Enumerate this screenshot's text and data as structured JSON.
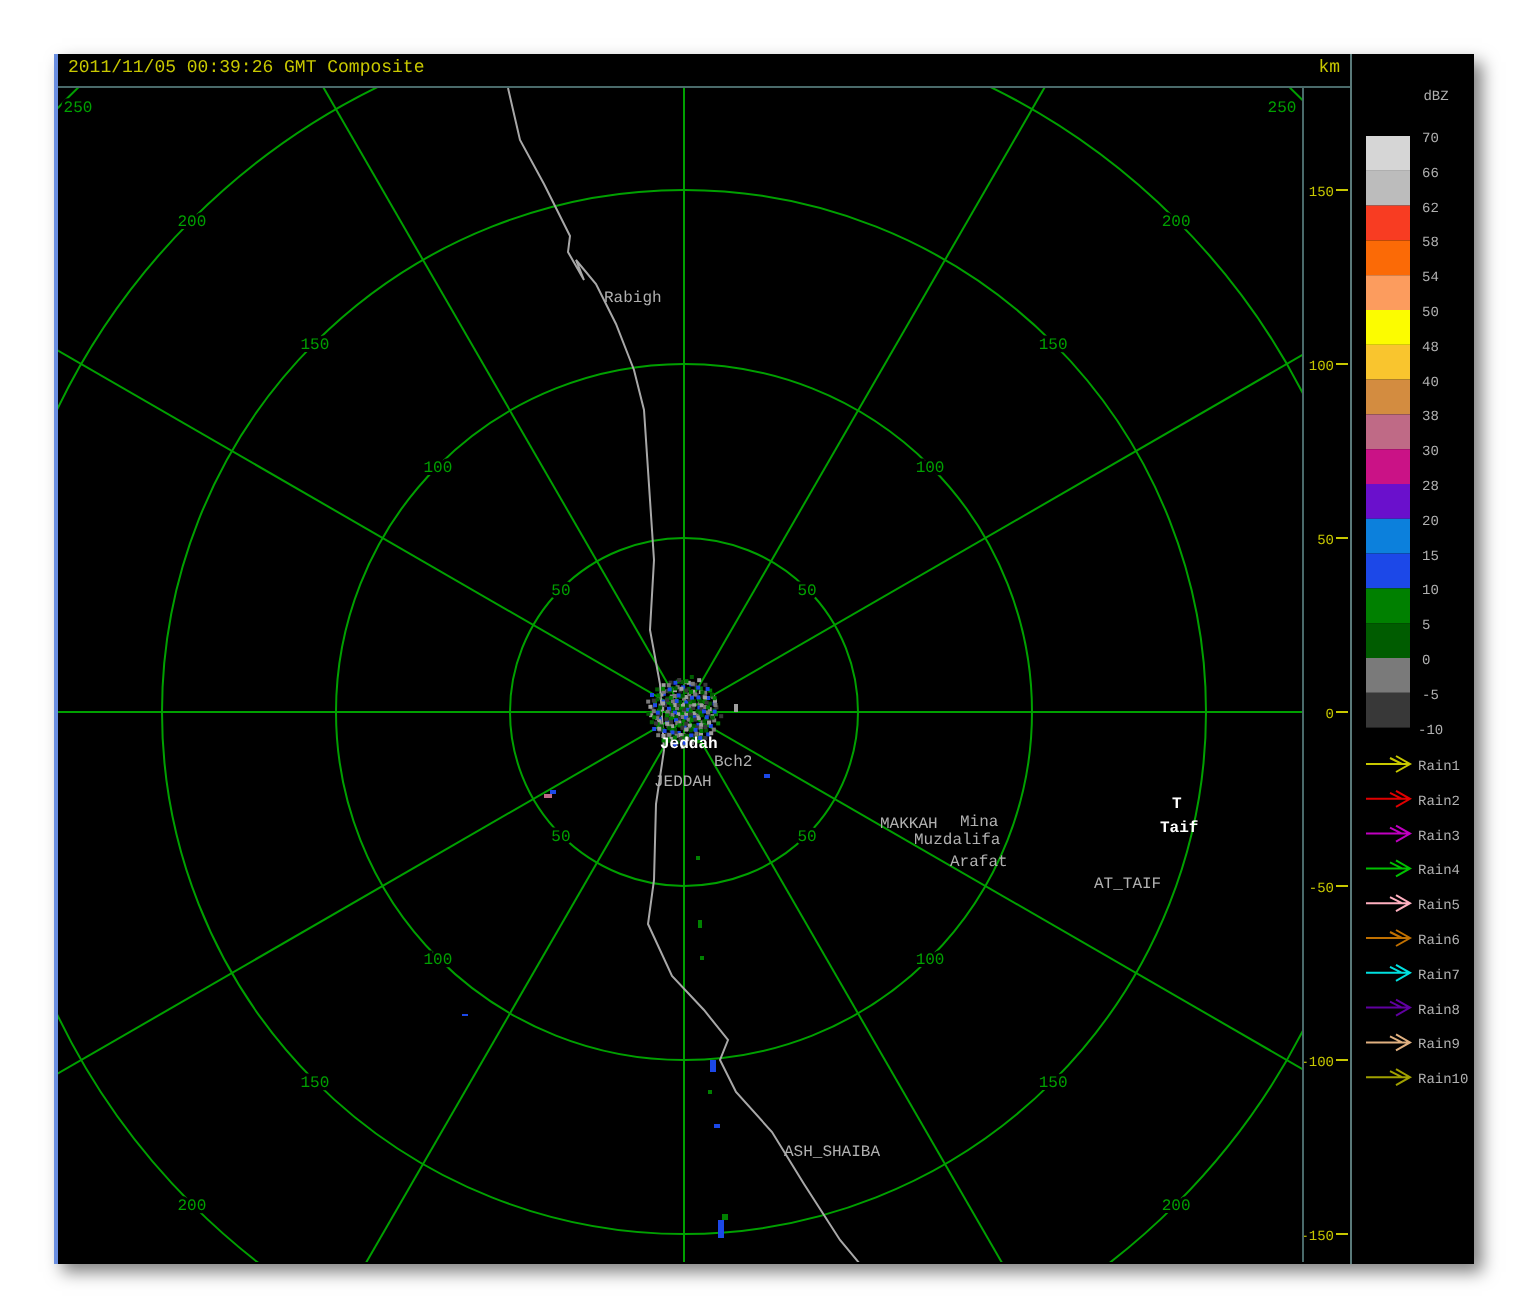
{
  "header": {
    "title": "2011/11/05 00:39:26 GMT Composite",
    "unit": "km"
  },
  "radar": {
    "ring_labels": [
      "250",
      "250",
      "200",
      "200",
      "150",
      "150",
      "100",
      "100",
      "50",
      "50",
      "50",
      "50",
      "100",
      "100",
      "150",
      "150",
      "200",
      "200"
    ],
    "places": [
      {
        "text": "Rabigh",
        "kind": "label"
      },
      {
        "text": "Jeddah",
        "kind": "station"
      },
      {
        "text": "Bch2",
        "kind": "label"
      },
      {
        "text": "JEDDAH",
        "kind": "label"
      },
      {
        "text": "MAKKAH",
        "kind": "label"
      },
      {
        "text": "Mina",
        "kind": "label"
      },
      {
        "text": "Muzdalifa",
        "kind": "label"
      },
      {
        "text": "Arafat",
        "kind": "label"
      },
      {
        "text": "T",
        "kind": "station"
      },
      {
        "text": "Taif",
        "kind": "station"
      },
      {
        "text": "AT_TAIF",
        "kind": "label"
      },
      {
        "text": "ASH_SHAIBA",
        "kind": "label"
      }
    ]
  },
  "km_axis": [
    "150",
    "100",
    "50",
    "0",
    "-50",
    "-100",
    "-150"
  ],
  "legend": {
    "title": "dBZ",
    "bottom_value": "-10",
    "scale": [
      {
        "value": "70",
        "color": "#d6d6d6"
      },
      {
        "value": "66",
        "color": "#bcbcbc"
      },
      {
        "value": "62",
        "color": "#f83c22"
      },
      {
        "value": "58",
        "color": "#fb6a06"
      },
      {
        "value": "54",
        "color": "#fc9c5e"
      },
      {
        "value": "50",
        "color": "#fcfc00"
      },
      {
        "value": "48",
        "color": "#f9c52e"
      },
      {
        "value": "40",
        "color": "#d38c40"
      },
      {
        "value": "38",
        "color": "#bf6a86"
      },
      {
        "value": "30",
        "color": "#ca1286"
      },
      {
        "value": "28",
        "color": "#6a10cc"
      },
      {
        "value": "20",
        "color": "#0c80dc"
      },
      {
        "value": "15",
        "color": "#1c48e8"
      },
      {
        "value": "10",
        "color": "#008000"
      },
      {
        "value": "5",
        "color": "#005c00"
      },
      {
        "value": "0",
        "color": "#7a7a7a"
      },
      {
        "value": "-5",
        "color": "#383838"
      }
    ],
    "tracks": [
      {
        "label": "Rain1",
        "color": "#c8c800"
      },
      {
        "label": "Rain2",
        "color": "#e00000"
      },
      {
        "label": "Rain3",
        "color": "#c000c0"
      },
      {
        "label": "Rain4",
        "color": "#00c000"
      },
      {
        "label": "Rain5",
        "color": "#ffb0c0"
      },
      {
        "label": "Rain6",
        "color": "#c07000"
      },
      {
        "label": "Rain7",
        "color": "#00e0e0"
      },
      {
        "label": "Rain8",
        "color": "#6000a0"
      },
      {
        "label": "Rain9",
        "color": "#e0b080"
      },
      {
        "label": "Rain10",
        "color": "#a0a000"
      }
    ]
  }
}
